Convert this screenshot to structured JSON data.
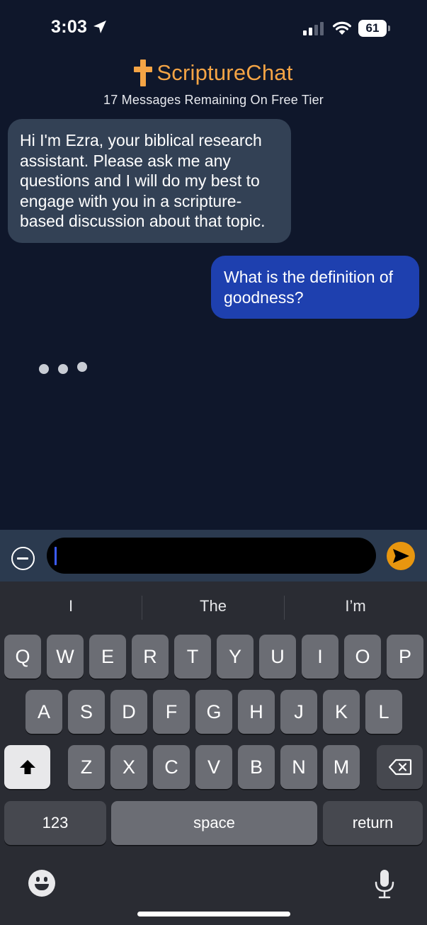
{
  "status_bar": {
    "time": "3:03",
    "battery": "61",
    "icons": [
      "location-arrow-icon",
      "cellular-signal-icon",
      "wifi-icon",
      "battery-icon"
    ]
  },
  "header": {
    "brand": "ScriptureChat",
    "subtitle": "17 Messages Remaining On Free Tier",
    "accent_color": "#f4a445"
  },
  "chat": {
    "messages": [
      {
        "role": "assistant",
        "text": "Hi I'm Ezra, your biblical research assistant. Please ask me any questions and I will do my best to engage with you in a scripture-based discussion about that topic."
      },
      {
        "role": "user",
        "text": "What is the definition of goodness?"
      }
    ],
    "typing": true,
    "assistant_bubble_color": "#334155",
    "user_bubble_color": "#1e40af"
  },
  "composer": {
    "input_value": "",
    "send_color": "#e8960f"
  },
  "keyboard": {
    "suggestions": [
      "I",
      "The",
      "I’m"
    ],
    "row1": [
      "Q",
      "W",
      "E",
      "R",
      "T",
      "Y",
      "U",
      "I",
      "O",
      "P"
    ],
    "row2": [
      "A",
      "S",
      "D",
      "F",
      "G",
      "H",
      "J",
      "K",
      "L"
    ],
    "row3": [
      "Z",
      "X",
      "C",
      "V",
      "B",
      "N",
      "M"
    ],
    "numbers_label": "123",
    "space_label": "space",
    "return_label": "return"
  }
}
